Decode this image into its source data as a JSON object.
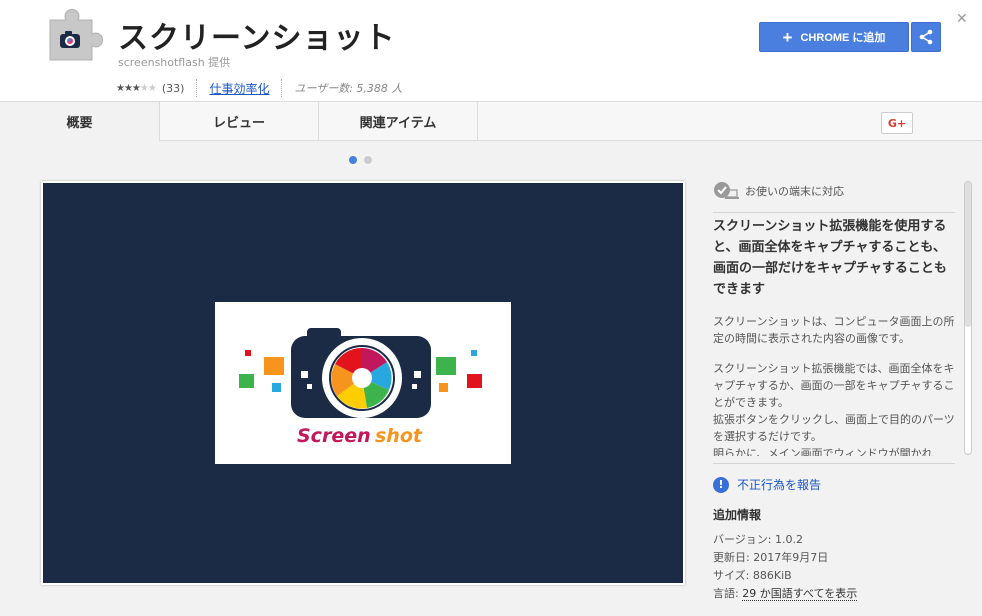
{
  "header": {
    "title": "スクリーンショット",
    "provider": "screenshotflash 提供",
    "rating": 3,
    "rating_count": "(33)",
    "category": "仕事効率化",
    "users": "ユーザー数: 5,388 人",
    "add_button": "CHROME に追加",
    "share_icon": "share-icon",
    "close_icon": "close-icon"
  },
  "tabs": [
    {
      "label": "概要",
      "active": true
    },
    {
      "label": "レビュー",
      "active": false
    },
    {
      "label": "関連アイテム",
      "active": false
    }
  ],
  "gplus_label": "G+",
  "carousel": {
    "total": 2,
    "active_index": 0
  },
  "screenshot": {
    "logo_text": "Screenshot",
    "background": "#1b2b45"
  },
  "details": {
    "compat": "お使いの端末に対応",
    "headline": "スクリーンショット拡張機能を使用すると、画面全体をキャプチャすることも、画面の一部だけをキャプチャすることもできます",
    "paragraph1": "スクリーンショットは、コンピュータ画面上の所定の時間に表示された内容の画像です。",
    "paragraph2": "スクリーンショット拡張機能では、画面全体をキャプチャするか、画面の一部をキャプチャすることができます。",
    "paragraph3": "拡張ボタンをクリックし、画面上で目的のパーツを選択するだけです。",
    "paragraph4": "明らかに、メイン画面でウィンドウが開かれ",
    "report": "不正行為を報告",
    "additional_title": "追加情報",
    "version": "バージョン: 1.0.2",
    "updated": "更新日: 2017年9月7日",
    "size": "サイズ: 886KiB",
    "language_prefix": "言語: ",
    "language_link": "29 か国語すべてを表示"
  },
  "colors": {
    "accent": "#4a7fe0",
    "link": "#1a56c4",
    "gplus": "#d73d32"
  }
}
